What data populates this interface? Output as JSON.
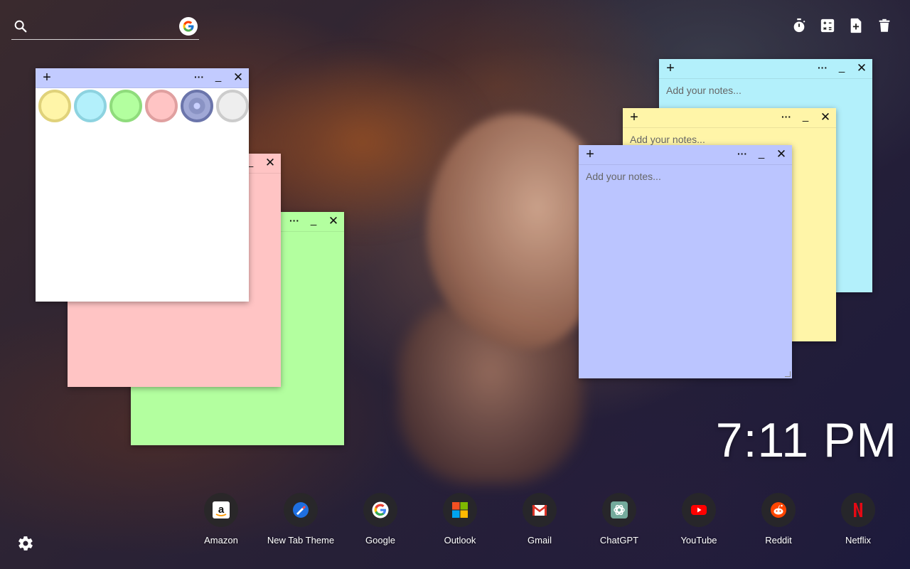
{
  "search": {
    "placeholder": ""
  },
  "toolbar": {
    "icons": [
      "timer-icon",
      "calculator-icon",
      "new-note-icon",
      "trash-icon"
    ]
  },
  "notes": {
    "cyan": {
      "placeholder": "Add your notes...",
      "color": "#b3f0fb"
    },
    "yellow": {
      "placeholder": "Add your notes...",
      "color": "#fff5a8"
    },
    "blue": {
      "placeholder": "Add your notes...",
      "color": "#bbc5ff"
    },
    "green": {
      "placeholder": "",
      "color": "#b3ff9f"
    },
    "pink": {
      "placeholder": "",
      "color": "#ffc4c4"
    },
    "white": {
      "placeholder": "",
      "color": "#ffffff",
      "header_color": "#c2cbff"
    }
  },
  "palette": {
    "colors": [
      {
        "name": "yellow",
        "fill": "#fff5a8",
        "ring": "#e0d27a"
      },
      {
        "name": "cyan",
        "fill": "#b3f0fb",
        "ring": "#8dd3e0"
      },
      {
        "name": "green",
        "fill": "#b3ff9f",
        "ring": "#8fdc7c"
      },
      {
        "name": "pink",
        "fill": "#ffc4c4",
        "ring": "#e0a0a0"
      },
      {
        "name": "purple",
        "fill": "#8a93c4",
        "ring": "#6b75ab"
      },
      {
        "name": "white",
        "fill": "#eeeeee",
        "ring": "#cccccc"
      }
    ]
  },
  "note_controls": {
    "add": "+",
    "more": "···",
    "minimize": "_",
    "close": "✕"
  },
  "clock": {
    "time": "7:11 PM"
  },
  "shortcuts": [
    {
      "label": "Amazon",
      "icon": "amazon-icon"
    },
    {
      "label": "New Tab Theme",
      "icon": "new-tab-theme-icon"
    },
    {
      "label": "Google",
      "icon": "google-icon"
    },
    {
      "label": "Outlook",
      "icon": "outlook-icon"
    },
    {
      "label": "Gmail",
      "icon": "gmail-icon"
    },
    {
      "label": "ChatGPT",
      "icon": "chatgpt-icon"
    },
    {
      "label": "YouTube",
      "icon": "youtube-icon"
    },
    {
      "label": "Reddit",
      "icon": "reddit-icon"
    },
    {
      "label": "Netflix",
      "icon": "netflix-icon"
    }
  ]
}
